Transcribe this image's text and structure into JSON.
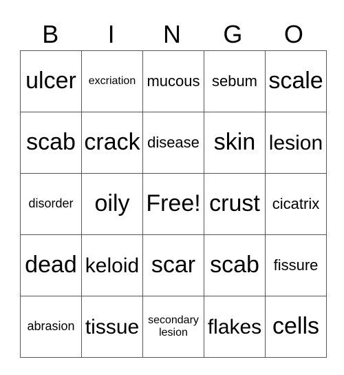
{
  "header": [
    "B",
    "I",
    "N",
    "G",
    "O"
  ],
  "rows": [
    [
      {
        "text": "ulcer",
        "size": "xl"
      },
      {
        "text": "excriation",
        "size": "xs"
      },
      {
        "text": "mucous",
        "size": "m"
      },
      {
        "text": "sebum",
        "size": "m"
      },
      {
        "text": "scale",
        "size": "xl"
      }
    ],
    [
      {
        "text": "scab",
        "size": "xl"
      },
      {
        "text": "crack",
        "size": "xl"
      },
      {
        "text": "disease",
        "size": "m"
      },
      {
        "text": "skin",
        "size": "xl"
      },
      {
        "text": "lesion",
        "size": "l"
      }
    ],
    [
      {
        "text": "disorder",
        "size": "s"
      },
      {
        "text": "oily",
        "size": "xl"
      },
      {
        "text": "Free!",
        "size": "xl"
      },
      {
        "text": "crust",
        "size": "xl"
      },
      {
        "text": "cicatrix",
        "size": "m"
      }
    ],
    [
      {
        "text": "dead",
        "size": "xl"
      },
      {
        "text": "keloid",
        "size": "l"
      },
      {
        "text": "scar",
        "size": "xl"
      },
      {
        "text": "scab",
        "size": "xl"
      },
      {
        "text": "fissure",
        "size": "m"
      }
    ],
    [
      {
        "text": "abrasion",
        "size": "s"
      },
      {
        "text": "tissue",
        "size": "l"
      },
      {
        "text": "secondary lesion",
        "size": "xs"
      },
      {
        "text": "flakes",
        "size": "l"
      },
      {
        "text": "cells",
        "size": "xl"
      }
    ]
  ]
}
